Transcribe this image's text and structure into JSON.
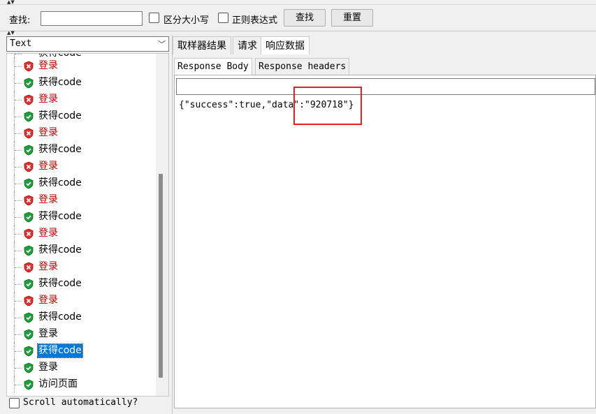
{
  "search": {
    "label": "查找:",
    "value": "",
    "case_sensitive_label": "区分大小写",
    "regex_label": "正则表达式",
    "find_button": "查找",
    "reset_button": "重置"
  },
  "left": {
    "combo_value": "Text",
    "partial_top_item": "获得code",
    "items": [
      {
        "label": "登录",
        "status": "error"
      },
      {
        "label": "获得code",
        "status": "ok"
      },
      {
        "label": "登录",
        "status": "error"
      },
      {
        "label": "获得code",
        "status": "ok"
      },
      {
        "label": "登录",
        "status": "error"
      },
      {
        "label": "获得code",
        "status": "ok"
      },
      {
        "label": "登录",
        "status": "error"
      },
      {
        "label": "获得code",
        "status": "ok"
      },
      {
        "label": "登录",
        "status": "error"
      },
      {
        "label": "获得code",
        "status": "ok"
      },
      {
        "label": "登录",
        "status": "error"
      },
      {
        "label": "获得code",
        "status": "ok"
      },
      {
        "label": "登录",
        "status": "error"
      },
      {
        "label": "获得code",
        "status": "ok"
      },
      {
        "label": "登录",
        "status": "error"
      },
      {
        "label": "获得code",
        "status": "ok"
      },
      {
        "label": "登录",
        "status": "ok"
      },
      {
        "label": "获得code",
        "status": "ok",
        "selected": true
      },
      {
        "label": "登录",
        "status": "ok"
      },
      {
        "label": "访问页面",
        "status": "ok"
      }
    ],
    "scroll_auto_label": "Scroll automatically?"
  },
  "right": {
    "tabs": [
      "取样器结果",
      "请求",
      "响应数据"
    ],
    "active_tab": 2,
    "sub_tabs": [
      "Response Body",
      "Response headers"
    ],
    "active_sub_tab": 0,
    "response_search_value": "",
    "response_body": "{\"success\":true,\"data\":\"920718\"}"
  },
  "colors": {
    "error_text": "#c00000",
    "selection": "#0078d7",
    "highlight_box": "#e02020"
  }
}
